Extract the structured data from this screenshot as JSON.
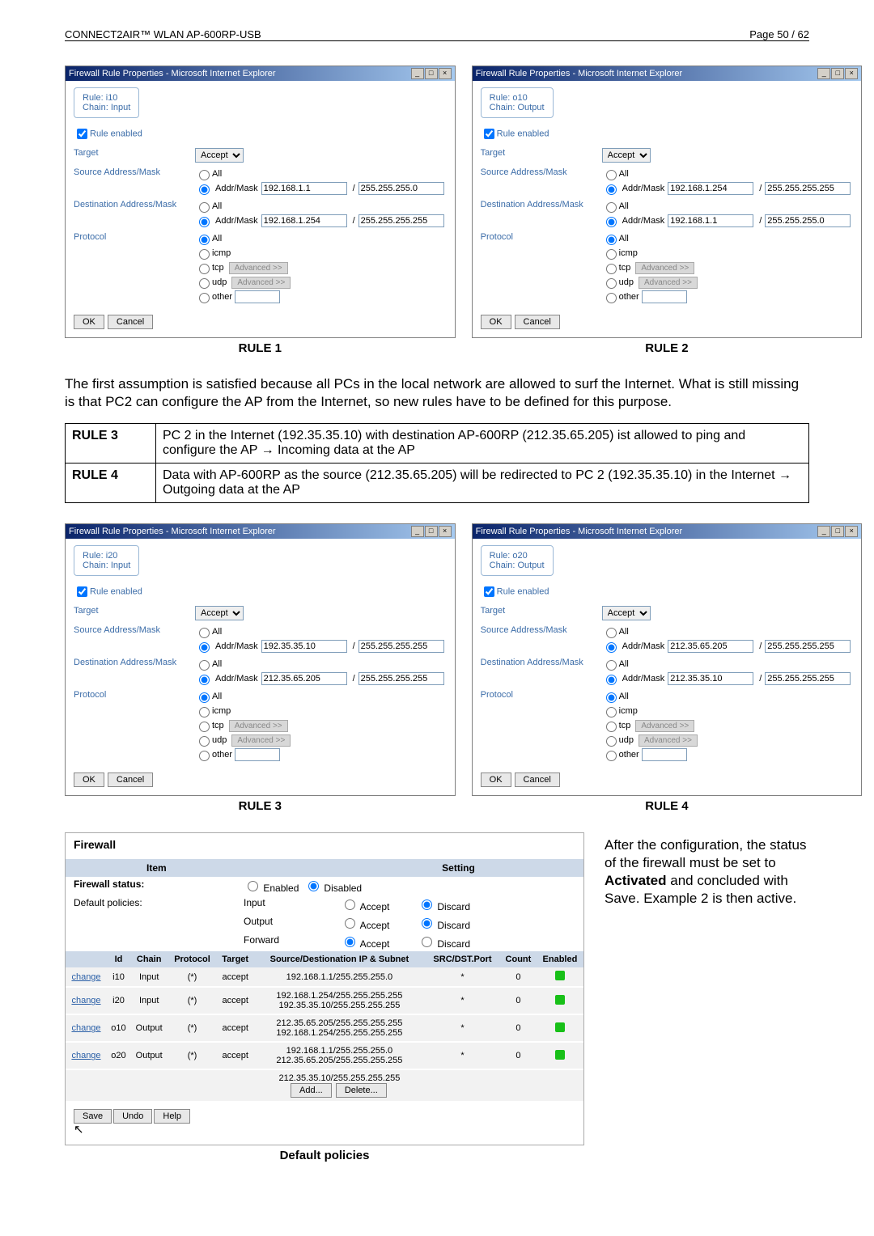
{
  "header": {
    "product": "CONNECT2AIR™ WLAN AP-600RP-USB",
    "page": "Page 50 / 62"
  },
  "rule1": {
    "title": "Firewall Rule Properties - Microsoft Internet Explorer",
    "rule_label": "Rule:",
    "rule_id": "i10",
    "chain_label": "Chain:",
    "chain_val": "Input",
    "enabled_label": "Rule enabled",
    "target_label": "Target",
    "target_val": "Accept",
    "src_label": "Source Address/Mask",
    "src_addr": "192.168.1.1",
    "src_mask": "255.255.255.0",
    "dst_label": "Destination Address/Mask",
    "dst_addr": "192.168.1.254",
    "dst_mask": "255.255.255.255",
    "proto_label": "Protocol",
    "ok": "OK",
    "cancel": "Cancel",
    "all": "All",
    "icmp": "icmp",
    "tcp": "tcp",
    "udp": "udp",
    "other": "other",
    "adv": "Advanced >>",
    "addrmask": "Addr/Mask",
    "caption": "RULE 1"
  },
  "rule2": {
    "title": "Firewall Rule Properties - Microsoft Internet Explorer",
    "rule_id": "o10",
    "chain_val": "Output",
    "src_addr": "192.168.1.254",
    "src_mask": "255.255.255.255",
    "dst_addr": "192.168.1.1",
    "dst_mask": "255.255.255.0",
    "caption": "RULE 2"
  },
  "para1": "The first assumption is satisfied because all PCs in the local network are allowed to surf the Internet. What is still missing is that PC2 can configure the AP from the Internet, so new rules have to be defined for this purpose.",
  "table1": {
    "r3_label": "RULE 3",
    "r3_text": "PC 2 in the Internet (192.35.35.10) with destination AP-600RP (212.35.65.205) ist allowed to ping and configure the AP → Incoming data at the AP",
    "r4_label": "RULE 4",
    "r4_text": "Data with AP-600RP as the source (212.35.65.205) will be redirected to PC 2 (192.35.35.10) in the Internet → Outgoing data at the AP"
  },
  "rule3": {
    "rule_id": "i20",
    "chain_val": "Input",
    "src_addr": "192.35.35.10",
    "src_mask": "255.255.255.255",
    "dst_addr": "212.35.65.205",
    "dst_mask": "255.255.255.255",
    "caption": "RULE 3"
  },
  "rule4": {
    "rule_id": "o20",
    "chain_val": "Output",
    "src_addr": "212.35.65.205",
    "src_mask": "255.255.255.255",
    "dst_addr": "212.35.35.10",
    "dst_mask": "255.255.255.255",
    "caption": "RULE 4"
  },
  "firewall": {
    "title": "Firewall",
    "item": "Item",
    "setting": "Setting",
    "status_label": "Firewall status:",
    "enabled": "Enabled",
    "disabled": "Disabled",
    "defpol": "Default policies:",
    "input": "Input",
    "output": "Output",
    "forward": "Forward",
    "accept": "Accept",
    "discard": "Discard",
    "cols": {
      "id": "Id",
      "chain": "Chain",
      "proto": "Protocol",
      "target": "Target",
      "subnet": "Source/Destionation IP & Subnet",
      "port": "SRC/DST.Port",
      "count": "Count",
      "enabled": "Enabled"
    },
    "rows": [
      {
        "link": "change",
        "id": "i10",
        "chain": "Input",
        "proto": "(*)",
        "target": "accept",
        "sub1": "192.168.1.1/255.255.255.0",
        "sub2": "",
        "port": "*",
        "count": "0"
      },
      {
        "link": "change",
        "id": "i20",
        "chain": "Input",
        "proto": "(*)",
        "target": "accept",
        "sub1": "192.168.1.254/255.255.255.255",
        "sub2": "192.35.35.10/255.255.255.255",
        "port": "*",
        "count": "0"
      },
      {
        "link": "change",
        "id": "o10",
        "chain": "Output",
        "proto": "(*)",
        "target": "accept",
        "sub1": "212.35.65.205/255.255.255.255",
        "sub2": "192.168.1.254/255.255.255.255",
        "port": "*",
        "count": "0"
      },
      {
        "link": "change",
        "id": "o20",
        "chain": "Output",
        "proto": "(*)",
        "target": "accept",
        "sub1": "192.168.1.1/255.255.255.0",
        "sub2": "212.35.65.205/255.255.255.255",
        "port": "*",
        "count": "0"
      }
    ],
    "extra_sub": "212.35.35.10/255.255.255.255",
    "add": "Add...",
    "delete": "Delete...",
    "save": "Save",
    "undo": "Undo",
    "help": "Help",
    "caption": "Default policies"
  },
  "para2_a": "After the configuration, the status of the firewall must be set to ",
  "para2_b": "Activated",
  "para2_c": " and concluded with Save. Example 2 is then active."
}
